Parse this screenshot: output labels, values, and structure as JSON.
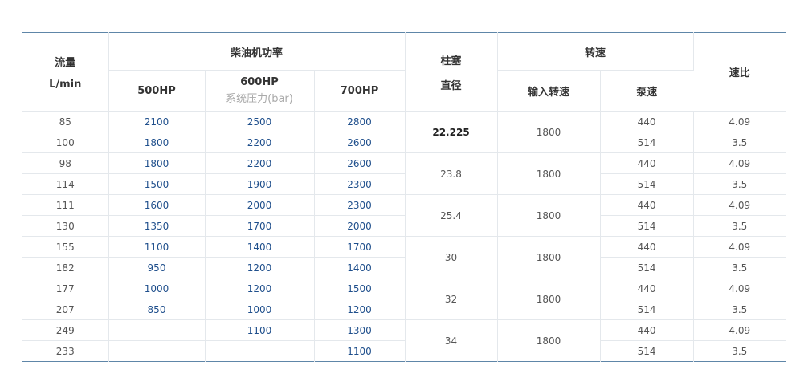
{
  "headers": {
    "flow": [
      "流量",
      "L/min"
    ],
    "engine_power": "柴油机功率",
    "hp": [
      "500HP",
      "600HP",
      "700HP"
    ],
    "system_pressure": "系统压力(bar)",
    "plunger": [
      "柱塞",
      "直径"
    ],
    "speed": "转速",
    "input_speed": "输入转速",
    "pump_speed": "泵速",
    "ratio": "速比"
  },
  "rows": [
    {
      "flow": "85",
      "p500": "2100",
      "p600": "2500",
      "p700": "2800",
      "pump": "440",
      "ratio": "4.09"
    },
    {
      "flow": "100",
      "p500": "1800",
      "p600": "2200",
      "p700": "2600",
      "pump": "514",
      "ratio": "3.5"
    },
    {
      "flow": "98",
      "p500": "1800",
      "p600": "2200",
      "p700": "2600",
      "pump": "440",
      "ratio": "4.09"
    },
    {
      "flow": "114",
      "p500": "1500",
      "p600": "1900",
      "p700": "2300",
      "pump": "514",
      "ratio": "3.5"
    },
    {
      "flow": "111",
      "p500": "1600",
      "p600": "2000",
      "p700": "2300",
      "pump": "440",
      "ratio": "4.09"
    },
    {
      "flow": "130",
      "p500": "1350",
      "p600": "1700",
      "p700": "2000",
      "pump": "514",
      "ratio": "3.5"
    },
    {
      "flow": "155",
      "p500": "1100",
      "p600": "1400",
      "p700": "1700",
      "pump": "440",
      "ratio": "4.09"
    },
    {
      "flow": "182",
      "p500": "950",
      "p600": "1200",
      "p700": "1400",
      "pump": "514",
      "ratio": "3.5"
    },
    {
      "flow": "177",
      "p500": "1000",
      "p600": "1200",
      "p700": "1500",
      "pump": "440",
      "ratio": "4.09"
    },
    {
      "flow": "207",
      "p500": "850",
      "p600": "1000",
      "p700": "1200",
      "pump": "514",
      "ratio": "3.5"
    },
    {
      "flow": "249",
      "p500": "",
      "p600": "1100",
      "p700": "1300",
      "pump": "440",
      "ratio": "4.09"
    },
    {
      "flow": "233",
      "p500": "",
      "p600": "",
      "p700": "1100",
      "pump": "514",
      "ratio": "3.5"
    }
  ],
  "groups": [
    {
      "diameter": "22.225",
      "input_speed": "1800"
    },
    {
      "diameter": "23.8",
      "input_speed": "1800"
    },
    {
      "diameter": "25.4",
      "input_speed": "1800"
    },
    {
      "diameter": "30",
      "input_speed": "1800"
    },
    {
      "diameter": "32",
      "input_speed": "1800"
    },
    {
      "diameter": "34",
      "input_speed": "1800"
    }
  ]
}
